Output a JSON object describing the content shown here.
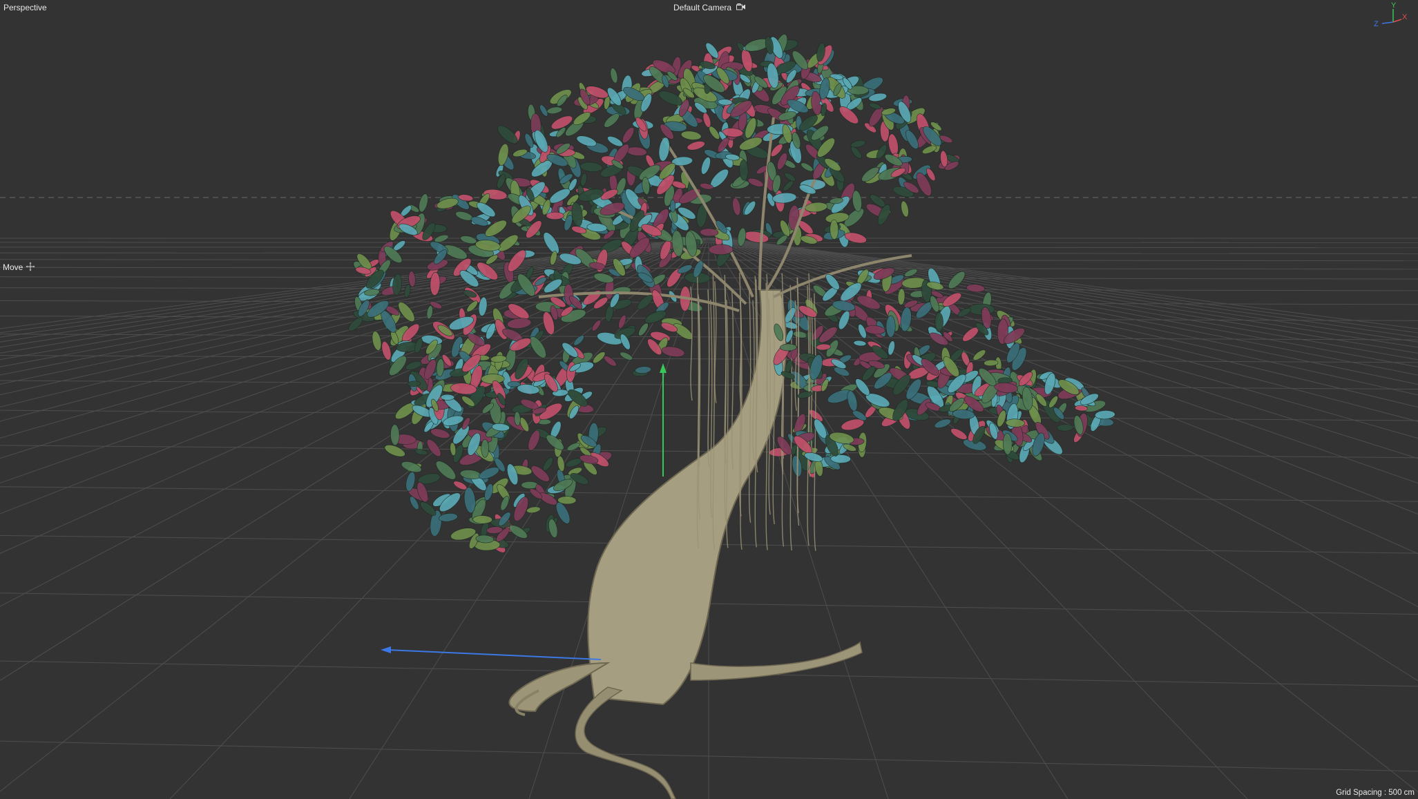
{
  "viewport": {
    "view_title": "Perspective",
    "camera_label": "Default Camera",
    "tool_label": "Move",
    "grid_spacing": "Grid Spacing : 500 cm"
  },
  "axis_gizmo": {
    "x": "X",
    "y": "Y",
    "z": "Z"
  },
  "icons": {
    "camera": "camera-icon",
    "move": "move-crosshair-icon"
  },
  "colors": {
    "background": "#333333",
    "grid": "#4e4e4e",
    "horizon": "#6a6a6a",
    "axis_x": "#e05050",
    "axis_y": "#38c85a",
    "axis_z": "#3c78e6",
    "trunk": "#a69e80",
    "leaf_green": "#4f7a55",
    "leaf_pink": "#c0506a",
    "leaf_cyan": "#5aa8b4"
  }
}
